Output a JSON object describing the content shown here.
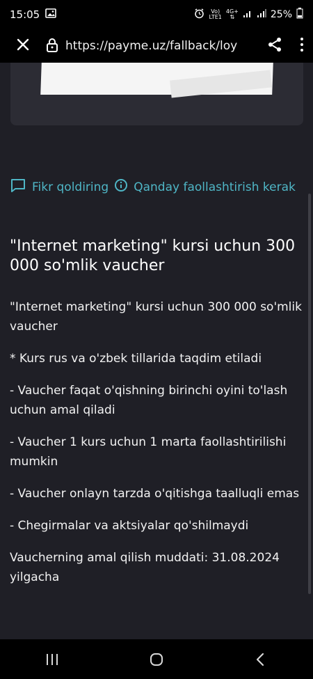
{
  "status_bar": {
    "time": "15:05",
    "network_top": "Vo)",
    "network_bottom": "LTE1",
    "network_label": "4G+",
    "battery": "25%"
  },
  "browser": {
    "url": "https://payme.uz/fallback/loy"
  },
  "actions": {
    "feedback": "Fikr qoldiring",
    "activation": "Qanday faollashtirish kerak"
  },
  "offer": {
    "title": "\"Internet marketing\" kursi uchun 300 000 so'mlik vaucher",
    "paragraphs": [
      "\"Internet marketing\" kursi uchun 300 000 so'mlik vaucher",
      "* Kurs rus va o'zbek tillarida taqdim etiladi",
      "- Vaucher faqat o'qishning birinchi oyini to'lash uchun amal qiladi",
      "- Vaucher 1 kurs uchun 1 marta faollashtirilishi mumkin",
      "- Vaucher onlayn tarzda o'qitishga taalluqli emas",
      "- Chegirmalar va aktsiyalar qo'shilmaydi",
      "Vaucherning amal qilish muddati: 31.08.2024 yilgacha"
    ]
  },
  "colors": {
    "accent": "#4fb6c6",
    "background": "#1f1f26",
    "card": "#2c2c34"
  },
  "icons": {
    "close": "close-icon",
    "lock": "lock-icon",
    "share": "share-icon",
    "menu": "more-vertical-icon",
    "feedback": "comment-icon",
    "info": "info-icon"
  }
}
